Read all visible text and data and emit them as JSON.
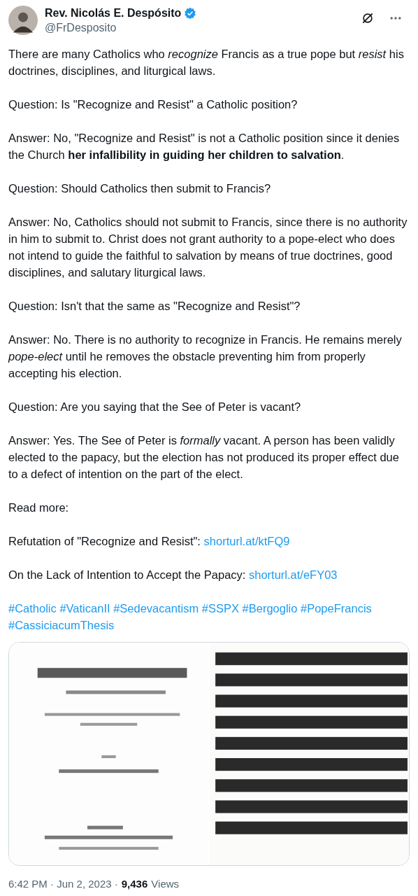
{
  "author": {
    "name": "Rev. Nicolás E. Despósito",
    "handle": "@FrDesposito",
    "verified": true
  },
  "paragraphs": [
    {
      "text": "There are many Catholics who *recognize* Francis as a true pope but *resist* his doctrines, disciplines, and liturgical laws."
    },
    {
      "text": "Question: Is \"Recognize and Resist\" a Catholic position?"
    },
    {
      "text": "Answer: No, \"Recognize and Resist\" is not a Catholic position since it denies the Church **her infallibility in guiding her children to salvation**."
    },
    {
      "text": "Question: Should Catholics then submit to Francis?"
    },
    {
      "text": "Answer: No, Catholics should not submit to Francis, since there is no authority in him to submit to. Christ does not grant authority to a pope-elect who does not intend to guide the faithful to salvation by means of true doctrines, good disciplines, and salutary liturgical laws."
    },
    {
      "text": "Question: Isn't that the same as \"Recognize and Resist\"?"
    },
    {
      "text": "Answer: No. There is no authority to recognize in Francis. He remains merely *pope-elect* until he removes the obstacle preventing him from properly accepting his election."
    },
    {
      "text": "Question: Are you saying that the See of Peter is vacant?"
    },
    {
      "text": "Answer: Yes. The See of Peter is *formally* vacant. A person has been validly elected to the papacy, but the election has not produced its proper effect due to a defect of intention on the part of the elect."
    },
    {
      "text": "Read more:"
    },
    {
      "text": "Refutation of \"Recognize and Resist\": ",
      "link": "shorturl.at/ktFQ9"
    },
    {
      "text": "On the Lack of Intention to Accept the Papacy: ",
      "link": "shorturl.at/eFY03"
    }
  ],
  "hashtags": [
    "#Catholic",
    "#VaticanII",
    "#Sedevacantism",
    "#SSPX",
    "#Bergoglio",
    "#PopeFrancis",
    "#CassiciacumThesis"
  ],
  "footer": {
    "time": "6:42 PM · Jun 2, 2023 ·",
    "views_count": "9,436",
    "views_label": "Views"
  }
}
